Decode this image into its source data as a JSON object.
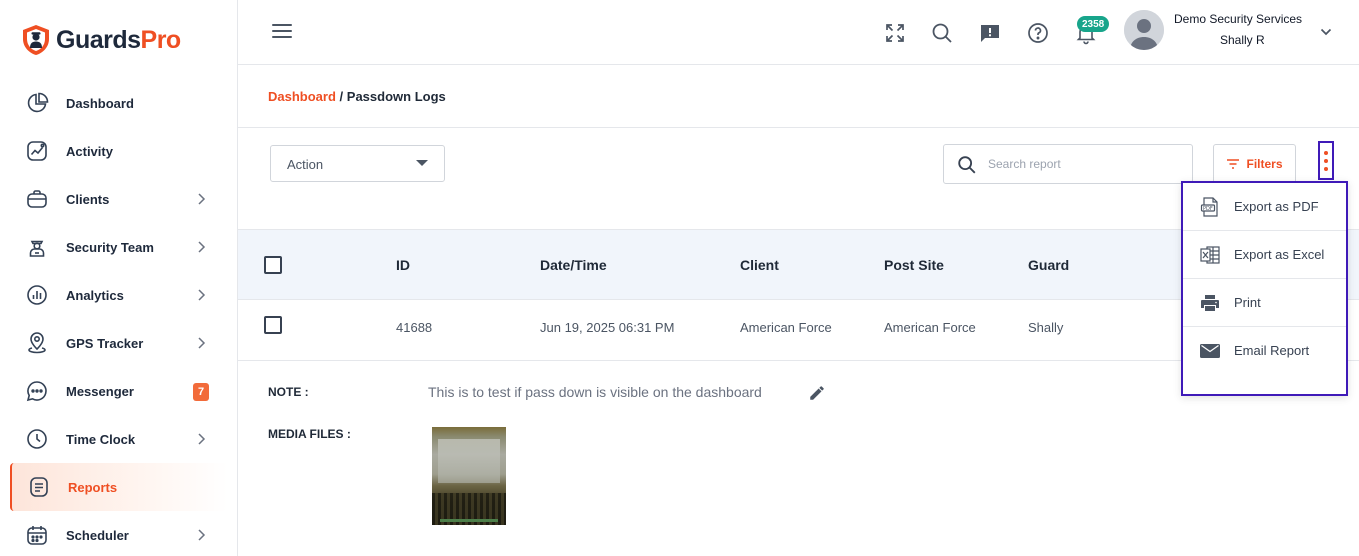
{
  "brand": {
    "part1": "Guards",
    "part2": "Pro",
    "accent": "#ef4f23"
  },
  "sidebar": {
    "items": [
      {
        "label": "Dashboard",
        "icon": "pie-chart-icon"
      },
      {
        "label": "Activity",
        "icon": "activity-chart-icon"
      },
      {
        "label": "Clients",
        "icon": "briefcase-icon"
      },
      {
        "label": "Security Team",
        "icon": "guard-icon"
      },
      {
        "label": "Analytics",
        "icon": "analytics-icon"
      },
      {
        "label": "GPS Tracker",
        "icon": "map-pin-icon"
      },
      {
        "label": "Messenger",
        "icon": "chat-icon",
        "badge": "7"
      },
      {
        "label": "Time Clock",
        "icon": "clock-icon"
      },
      {
        "label": "Reports",
        "icon": "report-icon",
        "active": true
      },
      {
        "label": "Scheduler",
        "icon": "calendar-icon"
      }
    ]
  },
  "header": {
    "notification_count": "2358",
    "company": "Demo Security Services",
    "user": "Shally R"
  },
  "breadcrumb": {
    "parent": "Dashboard",
    "separator": "/",
    "current": "Passdown Logs"
  },
  "toolbar": {
    "action_label": "Action",
    "search_placeholder": "Search report",
    "filters_label": "Filters"
  },
  "table": {
    "columns": [
      "ID",
      "Date/Time",
      "Client",
      "Post Site",
      "Guard"
    ],
    "rows": [
      {
        "id": "41688",
        "datetime": "Jun 19, 2025 06:31 PM",
        "client": "American Force",
        "post_site": "American Force",
        "guard": "Shally"
      }
    ]
  },
  "details": {
    "note_label": "NOTE :",
    "note_text": "This is to test if pass down is visible on the dashboard",
    "media_label": "MEDIA FILES :"
  },
  "menu": {
    "items": [
      {
        "label": "Export as PDF",
        "icon": "pdf-file-icon"
      },
      {
        "label": "Export as Excel",
        "icon": "excel-file-icon"
      },
      {
        "label": "Print",
        "icon": "printer-icon"
      },
      {
        "label": "Email Report",
        "icon": "email-icon"
      }
    ]
  }
}
